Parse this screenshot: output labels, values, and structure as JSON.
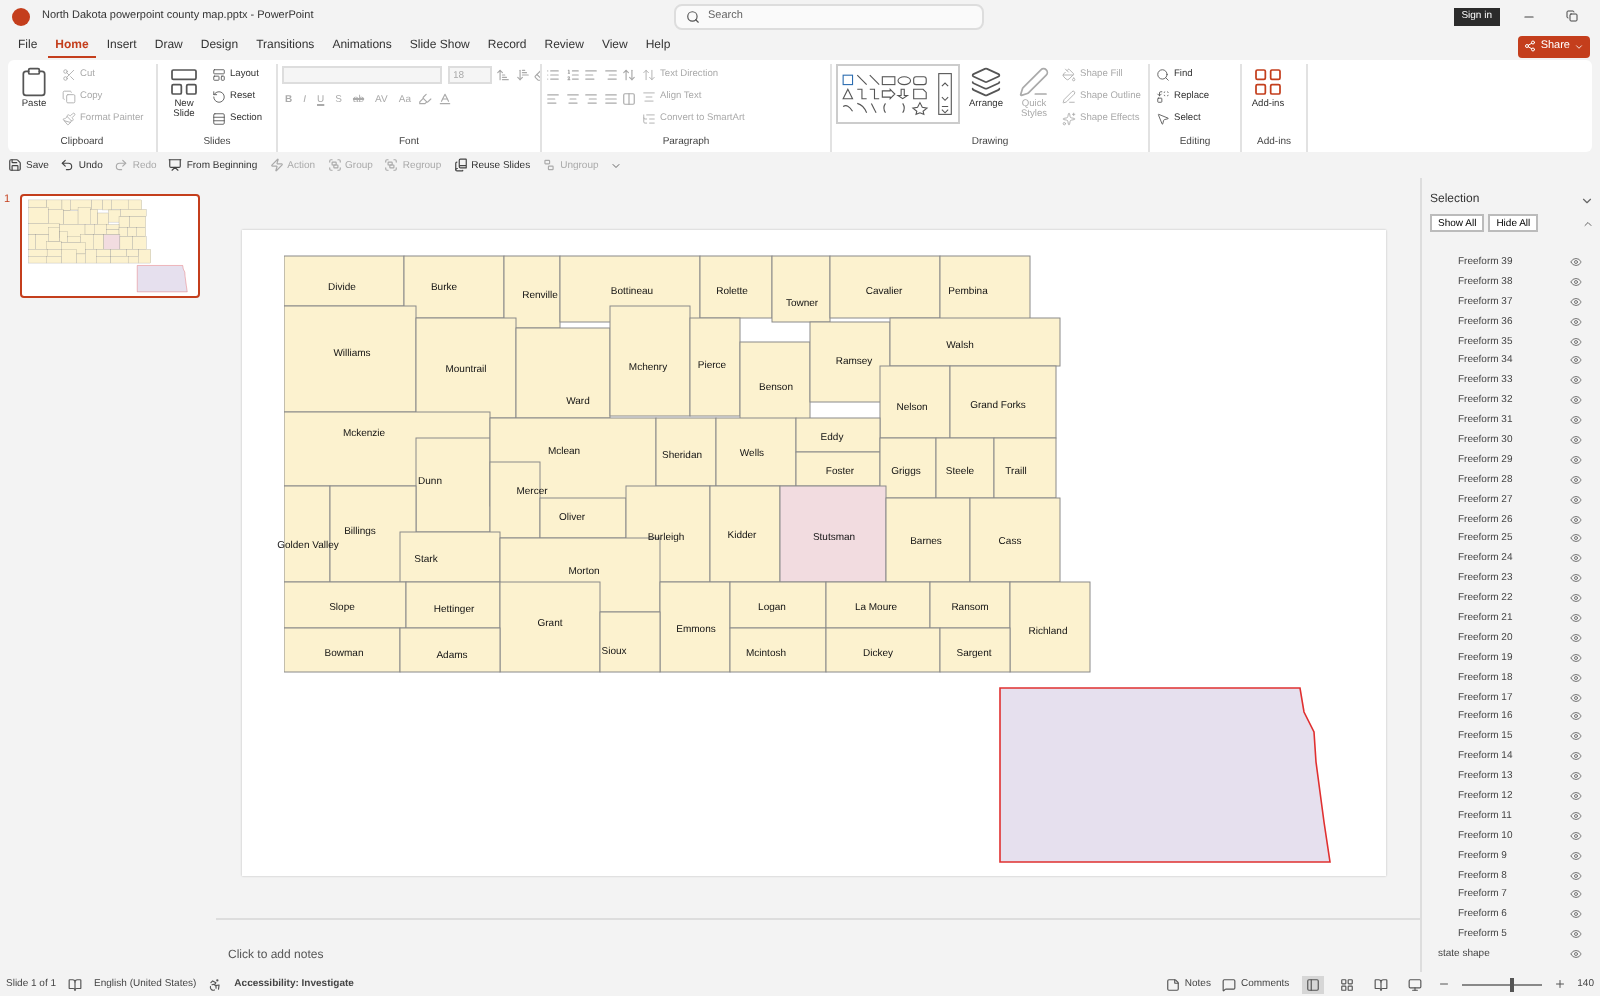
{
  "window": {
    "title": "North Dakota powerpoint county map.pptx  -  PowerPoint",
    "search_placeholder": "Search",
    "sign_in": "Sign in"
  },
  "menu_tabs": [
    {
      "label": "File",
      "selected": false
    },
    {
      "label": "Home",
      "selected": true
    },
    {
      "label": "Insert",
      "selected": false
    },
    {
      "label": "Draw",
      "selected": false
    },
    {
      "label": "Design",
      "selected": false
    },
    {
      "label": "Transitions",
      "selected": false
    },
    {
      "label": "Animations",
      "selected": false
    },
    {
      "label": "Slide Show",
      "selected": false
    },
    {
      "label": "Record",
      "selected": false
    },
    {
      "label": "Review",
      "selected": false
    },
    {
      "label": "View",
      "selected": false
    },
    {
      "label": "Help",
      "selected": false
    }
  ],
  "share": "Share",
  "ribbon": [
    {
      "label": "Clipboard",
      "kind": "commands",
      "columns": [
        [
          {
            "label": "Paste",
            "kind": "large",
            "disabled": false
          }
        ],
        [
          {
            "label": "Cut",
            "kind": "small",
            "disabled": true
          },
          {
            "label": "Copy",
            "kind": "small",
            "disabled": true
          },
          {
            "label": "Format Painter",
            "kind": "small",
            "disabled": true
          }
        ]
      ]
    },
    {
      "label": "Slides",
      "kind": "commands",
      "columns": [
        [
          {
            "label": "New Slide",
            "kind": "large",
            "disabled": false
          }
        ],
        [
          {
            "label": "Layout",
            "kind": "small",
            "disabled": false
          },
          {
            "label": "Reset",
            "kind": "small",
            "disabled": false
          },
          {
            "label": "Section",
            "kind": "small",
            "disabled": false
          }
        ]
      ]
    },
    {
      "label": "Font",
      "kind": "font",
      "disabled": true,
      "font_size": "18",
      "format_buttons": [
        "B",
        "I",
        "U",
        "S",
        "ab",
        "AV",
        "Aa"
      ]
    },
    {
      "label": "Paragraph",
      "kind": "paragraph",
      "disabled": true,
      "columns": [
        [
          {
            "label": "Text Direction",
            "kind": "small",
            "disabled": true
          },
          {
            "label": "Align Text",
            "kind": "small",
            "disabled": true
          },
          {
            "label": "Convert to SmartArt",
            "kind": "small",
            "disabled": true
          }
        ]
      ]
    },
    {
      "label": "Drawing",
      "kind": "drawing",
      "columns": [
        [
          {
            "label": "Arrange",
            "kind": "large",
            "disabled": false
          }
        ],
        [
          {
            "label": "Quick Styles",
            "kind": "large",
            "disabled": true
          }
        ],
        [
          {
            "label": "Shape Fill",
            "kind": "small",
            "disabled": true
          },
          {
            "label": "Shape Outline",
            "kind": "small",
            "disabled": true
          },
          {
            "label": "Shape Effects",
            "kind": "small",
            "disabled": true
          }
        ]
      ]
    },
    {
      "label": "Editing",
      "kind": "commands",
      "columns": [
        [
          {
            "label": "Find",
            "kind": "small",
            "disabled": false
          },
          {
            "label": "Replace",
            "kind": "small",
            "disabled": false
          },
          {
            "label": "Select",
            "kind": "small",
            "disabled": false
          }
        ]
      ]
    },
    {
      "label": "Add-ins",
      "kind": "commands",
      "columns": [
        [
          {
            "label": "Add-ins",
            "kind": "large",
            "disabled": false
          }
        ]
      ]
    }
  ],
  "quick_access": [
    {
      "label": "Save",
      "disabled": false
    },
    {
      "label": "Undo",
      "disabled": false
    },
    {
      "label": "Redo",
      "disabled": true
    },
    {
      "label": "From Beginning",
      "disabled": false
    },
    {
      "label": "Action",
      "disabled": true
    },
    {
      "label": "Group",
      "disabled": true
    },
    {
      "label": "Regroup",
      "disabled": true
    },
    {
      "label": "Reuse Slides",
      "disabled": false
    },
    {
      "label": "Ungroup",
      "disabled": true
    }
  ],
  "slides": [
    {
      "number": "1",
      "selected": true
    }
  ],
  "counties": [
    {
      "name": "Divide",
      "selected": false
    },
    {
      "name": "Burke",
      "selected": false
    },
    {
      "name": "Renville",
      "selected": false
    },
    {
      "name": "Bottineau",
      "selected": false
    },
    {
      "name": "Rolette",
      "selected": false
    },
    {
      "name": "Towner",
      "selected": false
    },
    {
      "name": "Cavalier",
      "selected": false
    },
    {
      "name": "Pembina",
      "selected": false
    },
    {
      "name": "Williams",
      "selected": false
    },
    {
      "name": "Mountrail",
      "selected": false
    },
    {
      "name": "Ward",
      "selected": false
    },
    {
      "name": "Mchenry",
      "selected": false
    },
    {
      "name": "Pierce",
      "selected": false
    },
    {
      "name": "Benson",
      "selected": false
    },
    {
      "name": "Ramsey",
      "selected": false
    },
    {
      "name": "Walsh",
      "selected": false
    },
    {
      "name": "Nelson",
      "selected": false
    },
    {
      "name": "Grand Forks",
      "selected": false
    },
    {
      "name": "Mckenzie",
      "selected": false
    },
    {
      "name": "Dunn",
      "selected": false
    },
    {
      "name": "Mclean",
      "selected": false
    },
    {
      "name": "Sheridan",
      "selected": false
    },
    {
      "name": "Wells",
      "selected": false
    },
    {
      "name": "Eddy",
      "selected": false
    },
    {
      "name": "Foster",
      "selected": false
    },
    {
      "name": "Griggs",
      "selected": false
    },
    {
      "name": "Steele",
      "selected": false
    },
    {
      "name": "Traill",
      "selected": false
    },
    {
      "name": "Mercer",
      "selected": false
    },
    {
      "name": "Oliver",
      "selected": false
    },
    {
      "name": "Golden Valley",
      "selected": false
    },
    {
      "name": "Billings",
      "selected": false
    },
    {
      "name": "Stark",
      "selected": false
    },
    {
      "name": "Burleigh",
      "selected": false
    },
    {
      "name": "Kidder",
      "selected": false
    },
    {
      "name": "Stutsman",
      "selected": true
    },
    {
      "name": "Barnes",
      "selected": false
    },
    {
      "name": "Cass",
      "selected": false
    },
    {
      "name": "Morton",
      "selected": false
    },
    {
      "name": "Slope",
      "selected": false
    },
    {
      "name": "Hettinger",
      "selected": false
    },
    {
      "name": "Grant",
      "selected": false
    },
    {
      "name": "Emmons",
      "selected": false
    },
    {
      "name": "Logan",
      "selected": false
    },
    {
      "name": "La Moure",
      "selected": false
    },
    {
      "name": "Ransom",
      "selected": false
    },
    {
      "name": "Richland",
      "selected": false
    },
    {
      "name": "Bowman",
      "selected": false
    },
    {
      "name": "Adams",
      "selected": false
    },
    {
      "name": "Sioux",
      "selected": false
    },
    {
      "name": "Mcintosh",
      "selected": false
    },
    {
      "name": "Dickey",
      "selected": false
    },
    {
      "name": "Sargent",
      "selected": false
    }
  ],
  "notes_placeholder": "Click to add notes",
  "selection_pane": {
    "title": "Selection",
    "buttons": [
      "Show All",
      "Hide All"
    ],
    "objects": [
      {
        "children": [
          {
            "name": "Freeform 39",
            "visible": true
          },
          {
            "name": "Freeform 38",
            "visible": true
          },
          {
            "name": "Freeform 37",
            "visible": true
          },
          {
            "name": "Freeform 36",
            "visible": true
          },
          {
            "name": "Freeform 35",
            "visible": true
          },
          {
            "name": "Freeform 34",
            "visible": true
          },
          {
            "name": "Freeform 33",
            "visible": true
          },
          {
            "name": "Freeform 32",
            "visible": true
          },
          {
            "name": "Freeform 31",
            "visible": true
          },
          {
            "name": "Freeform 30",
            "visible": true
          },
          {
            "name": "Freeform 29",
            "visible": true
          },
          {
            "name": "Freeform 28",
            "visible": true
          },
          {
            "name": "Freeform 27",
            "visible": true
          },
          {
            "name": "Freeform 26",
            "visible": true
          },
          {
            "name": "Freeform 25",
            "visible": true
          },
          {
            "name": "Freeform 24",
            "visible": true
          },
          {
            "name": "Freeform 23",
            "visible": true
          },
          {
            "name": "Freeform 22",
            "visible": true
          },
          {
            "name": "Freeform 21",
            "visible": true
          },
          {
            "name": "Freeform 20",
            "visible": true
          },
          {
            "name": "Freeform 19",
            "visible": true
          },
          {
            "name": "Freeform 18",
            "visible": true
          },
          {
            "name": "Freeform 17",
            "visible": true
          },
          {
            "name": "Freeform 16",
            "visible": true
          },
          {
            "name": "Freeform 15",
            "visible": true
          },
          {
            "name": "Freeform 14",
            "visible": true
          },
          {
            "name": "Freeform 13",
            "visible": true
          },
          {
            "name": "Freeform 12",
            "visible": true
          },
          {
            "name": "Freeform 11",
            "visible": true
          },
          {
            "name": "Freeform 10",
            "visible": true
          },
          {
            "name": "Freeform 9",
            "visible": true
          },
          {
            "name": "Freeform 8",
            "visible": true
          },
          {
            "name": "Freeform 7",
            "visible": true
          },
          {
            "name": "Freeform 6",
            "visible": true
          },
          {
            "name": "Freeform 5",
            "visible": true
          }
        ]
      },
      {
        "name": "state shape",
        "visible": true
      }
    ]
  },
  "status_bar": {
    "slide": "Slide 1 of 1",
    "language": "English (United States)",
    "accessibility": "Accessibility: Investigate",
    "notes": "Notes",
    "comments": "Comments",
    "views": [
      {
        "selected": true
      },
      {
        "selected": false
      },
      {
        "selected": false
      },
      {
        "selected": false
      }
    ],
    "zoom": {
      "level": 0.6,
      "reading": "140"
    }
  }
}
